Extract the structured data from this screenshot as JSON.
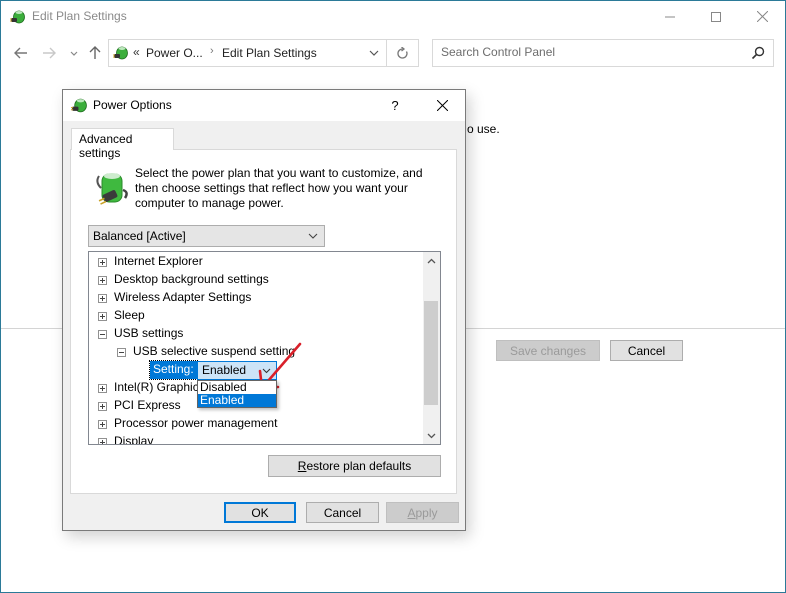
{
  "window": {
    "title": "Edit Plan Settings",
    "controls": {
      "minimize": "minimize",
      "maximize": "maximize",
      "close": "close"
    }
  },
  "navigation": {
    "back_icon": "arrow-left-icon",
    "forward_icon": "arrow-right-icon",
    "recent_icon": "chevron-down-icon",
    "up_icon": "arrow-up-icon",
    "address": {
      "overflow": "«",
      "breadcrumbs": [
        "Power O...",
        "Edit Plan Settings"
      ],
      "separator": "›"
    },
    "refresh_icon": "refresh-icon",
    "search": {
      "placeholder": "Search Control Panel",
      "value": ""
    }
  },
  "background": {
    "partial_text": "o use.",
    "buttons": {
      "save_changes": "Save changes",
      "cancel": "Cancel"
    }
  },
  "dialog": {
    "title": "Power Options",
    "help": "?",
    "tab": "Advanced settings",
    "intro": "Select the power plan that you want to customize, and then choose settings that reflect how you want your computer to manage power.",
    "plan_select": {
      "value": "Balanced [Active]"
    },
    "tree": [
      {
        "label": "Internet Explorer",
        "expanded": false,
        "level": 0
      },
      {
        "label": "Desktop background settings",
        "expanded": false,
        "level": 0
      },
      {
        "label": "Wireless Adapter Settings",
        "expanded": false,
        "level": 0
      },
      {
        "label": "Sleep",
        "expanded": false,
        "level": 0
      },
      {
        "label": "USB settings",
        "expanded": true,
        "level": 0
      },
      {
        "label": "USB selective suspend setting",
        "expanded": true,
        "level": 1
      },
      {
        "label": "Intel(R) Graphics Settings",
        "expanded": false,
        "level": 0
      },
      {
        "label": "PCI Express",
        "expanded": false,
        "level": 0
      },
      {
        "label": "Processor power management",
        "expanded": false,
        "level": 0
      },
      {
        "label": "Display",
        "expanded": false,
        "level": 0
      }
    ],
    "setting": {
      "label": "Setting:",
      "value": "Enabled",
      "options": [
        "Disabled",
        "Enabled"
      ],
      "selected_option": "Enabled"
    },
    "restore_button": {
      "underline": "R",
      "rest": "estore plan defaults"
    },
    "buttons": {
      "ok": "OK",
      "cancel": "Cancel",
      "apply_underline": "A",
      "apply_rest": "pply"
    },
    "annotation_color": "#d9202a"
  },
  "colors": {
    "accent": "#0078d7",
    "window_border": "#2b7a98"
  }
}
